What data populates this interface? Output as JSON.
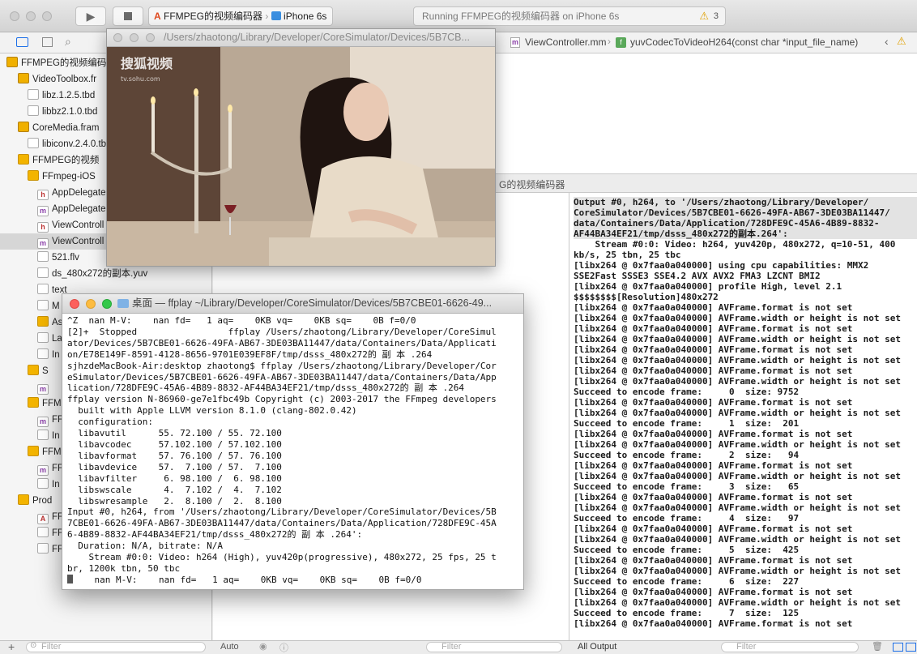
{
  "toolbar": {
    "scheme_name": "FFMPEG的视频编码器",
    "device": "iPhone 6s",
    "status_text": "Running FFMPEG的视频编码器 on iPhone 6s",
    "warning_count": "3"
  },
  "jumpbar": {
    "file": "ViewController.mm",
    "function": "yuvCodecToVideoH264(const char *input_file_name)"
  },
  "navigator": {
    "items": [
      {
        "label": "FFMPEG的视频编码器",
        "icon": "project-icon"
      },
      {
        "label": "VideoToolbox.fr",
        "icon": "framework-icon"
      },
      {
        "label": "libz.1.2.5.tbd",
        "icon": "file-icon"
      },
      {
        "label": "libbz2.1.0.tbd",
        "icon": "file-icon"
      },
      {
        "label": "CoreMedia.fram",
        "icon": "framework-icon"
      },
      {
        "label": "libiconv.2.4.0.tb",
        "icon": "file-icon"
      },
      {
        "label": "FFMPEG的视频",
        "icon": "folder-icon"
      },
      {
        "label": "FFmpeg-iOS",
        "icon": "folder-icon"
      },
      {
        "label": "AppDelegate",
        "icon": "header-file-icon"
      },
      {
        "label": "AppDelegate",
        "icon": "m-file-icon"
      },
      {
        "label": "ViewControll",
        "icon": "header-file-icon"
      },
      {
        "label": "ViewControll",
        "icon": "m-file-icon"
      },
      {
        "label": "521.flv",
        "icon": "video-file-icon"
      },
      {
        "label": "ds_480x272的副本.yuv",
        "icon": "file-icon"
      },
      {
        "label": "text",
        "icon": "file-icon"
      },
      {
        "label": "M",
        "icon": "file-icon"
      },
      {
        "label": "As",
        "icon": "asset-icon"
      },
      {
        "label": "La",
        "icon": "file-icon"
      },
      {
        "label": "In",
        "icon": "file-icon"
      },
      {
        "label": "S",
        "icon": "folder-icon"
      },
      {
        "label": "",
        "icon": "m-file-icon"
      },
      {
        "label": "FFM",
        "icon": "folder-icon"
      },
      {
        "label": "FF",
        "icon": "m-file-icon"
      },
      {
        "label": "In",
        "icon": "file-icon"
      },
      {
        "label": "FFM",
        "icon": "folder-icon"
      },
      {
        "label": "FF",
        "icon": "m-file-icon"
      },
      {
        "label": "In",
        "icon": "file-icon"
      },
      {
        "label": "Prod",
        "icon": "folder-icon"
      },
      {
        "label": "FF",
        "icon": "app-icon"
      },
      {
        "label": "FF",
        "icon": "product-icon"
      },
      {
        "label": "FF",
        "icon": "product-icon"
      }
    ],
    "filter_placeholder": "Filter"
  },
  "debug_bar": {
    "target_label": "G的视频编码器"
  },
  "bottom": {
    "auto_label": "Auto",
    "vars_filter_placeholder": "Filter",
    "output_label": "All Output",
    "console_filter_placeholder": "Filter"
  },
  "player": {
    "title": "/Users/zhaotong/Library/Developer/CoreSimulator/Devices/5B7CB...",
    "watermark": "搜狐视频",
    "watermark_sub": "tv.sohu.com"
  },
  "terminal": {
    "title": "桌面 — ffplay ~/Library/Developer/CoreSimulator/Devices/5B7CBE01-6626-49...",
    "lines": [
      "^Z  nan M-V:    nan fd=   1 aq=    0KB vq=    0KB sq=    0B f=0/0",
      "[2]+  Stopped                 ffplay /Users/zhaotong/Library/Developer/CoreSimul",
      "ator/Devices/5B7CBE01-6626-49FA-AB67-3DE03BA11447/data/Containers/Data/Applicati",
      "on/E78E149F-8591-4128-8656-9701E039EF8F/tmp/dsss_480x272的 副 本 .264",
      "sjhzdeMacBook-Air:desktop zhaotong$ ffplay /Users/zhaotong/Library/Developer/Cor",
      "eSimulator/Devices/5B7CBE01-6626-49FA-AB67-3DE03BA11447/data/Containers/Data/App",
      "lication/728DFE9C-45A6-4B89-8832-AF44BA34EF21/tmp/dsss_480x272的 副 本 .264",
      "ffplay version N-86960-ge7e1fbc49b Copyright (c) 2003-2017 the FFmpeg developers",
      "  built with Apple LLVM version 8.1.0 (clang-802.0.42)",
      "  configuration:",
      "  libavutil      55. 72.100 / 55. 72.100",
      "  libavcodec     57.102.100 / 57.102.100",
      "  libavformat    57. 76.100 / 57. 76.100",
      "  libavdevice    57.  7.100 / 57.  7.100",
      "  libavfilter     6. 98.100 /  6. 98.100",
      "  libswscale      4.  7.102 /  4.  7.102",
      "  libswresample   2.  8.100 /  2.  8.100",
      "Input #0, h264, from '/Users/zhaotong/Library/Developer/CoreSimulator/Devices/5B",
      "7CBE01-6626-49FA-AB67-3DE03BA11447/data/Containers/Data/Application/728DFE9C-45A",
      "6-4B89-8832-AF44BA34EF21/tmp/dsss_480x272的 副 本 .264':",
      "  Duration: N/A, bitrate: N/A",
      "    Stream #0:0: Video: h264 (High), yuv420p(progressive), 480x272, 25 fps, 25 t",
      "br, 1200k tbn, 50 tbc"
    ],
    "last_line": "    nan M-V:    nan fd=   1 aq=    0KB vq=    0KB sq=    0B f=0/0"
  },
  "console": {
    "lines": [
      {
        "t": "Output #0, h264, to '/Users/zhaotong/Library/Developer/",
        "hl": true
      },
      {
        "t": "CoreSimulator/Devices/5B7CBE01-6626-49FA-AB67-3DE03BA11447/",
        "hl": true
      },
      {
        "t": "data/Containers/Data/Application/728DFE9C-45A6-4B89-8832-",
        "hl": true
      },
      {
        "t": "AF44BA34EF21/tmp/dsss_480x272的副本.264':",
        "hl": true
      },
      {
        "t": "    Stream #0:0: Video: h264, yuv420p, 480x272, q=10-51, 400",
        "hl": false
      },
      {
        "t": "kb/s, 25 tbn, 25 tbc",
        "hl": false
      },
      {
        "t": "[libx264 @ 0x7faa0a040000] using cpu capabilities: MMX2",
        "hl": false
      },
      {
        "t": "SSE2Fast SSSE3 SSE4.2 AVX AVX2 FMA3 LZCNT BMI2",
        "hl": false
      },
      {
        "t": "[libx264 @ 0x7faa0a040000] profile High, level 2.1",
        "hl": false
      },
      {
        "t": "$$$$$$$$[Resolution]480x272",
        "hl": false
      },
      {
        "t": "[libx264 @ 0x7faa0a040000] AVFrame.format is not set",
        "hl": false
      },
      {
        "t": "[libx264 @ 0x7faa0a040000] AVFrame.width or height is not set",
        "hl": false
      },
      {
        "t": "[libx264 @ 0x7faa0a040000] AVFrame.format is not set",
        "hl": false
      },
      {
        "t": "[libx264 @ 0x7faa0a040000] AVFrame.width or height is not set",
        "hl": false
      },
      {
        "t": "[libx264 @ 0x7faa0a040000] AVFrame.format is not set",
        "hl": false
      },
      {
        "t": "[libx264 @ 0x7faa0a040000] AVFrame.width or height is not set",
        "hl": false
      },
      {
        "t": "[libx264 @ 0x7faa0a040000] AVFrame.format is not set",
        "hl": false
      },
      {
        "t": "[libx264 @ 0x7faa0a040000] AVFrame.width or height is not set",
        "hl": false
      },
      {
        "t": "Succeed to encode frame:     0  size: 9752",
        "hl": false
      },
      {
        "t": "[libx264 @ 0x7faa0a040000] AVFrame.format is not set",
        "hl": false
      },
      {
        "t": "[libx264 @ 0x7faa0a040000] AVFrame.width or height is not set",
        "hl": false
      },
      {
        "t": "Succeed to encode frame:     1  size:  201",
        "hl": false
      },
      {
        "t": "[libx264 @ 0x7faa0a040000] AVFrame.format is not set",
        "hl": false
      },
      {
        "t": "[libx264 @ 0x7faa0a040000] AVFrame.width or height is not set",
        "hl": false
      },
      {
        "t": "Succeed to encode frame:     2  size:   94",
        "hl": false
      },
      {
        "t": "[libx264 @ 0x7faa0a040000] AVFrame.format is not set",
        "hl": false
      },
      {
        "t": "[libx264 @ 0x7faa0a040000] AVFrame.width or height is not set",
        "hl": false
      },
      {
        "t": "Succeed to encode frame:     3  size:   65",
        "hl": false
      },
      {
        "t": "[libx264 @ 0x7faa0a040000] AVFrame.format is not set",
        "hl": false
      },
      {
        "t": "[libx264 @ 0x7faa0a040000] AVFrame.width or height is not set",
        "hl": false
      },
      {
        "t": "Succeed to encode frame:     4  size:   97",
        "hl": false
      },
      {
        "t": "[libx264 @ 0x7faa0a040000] AVFrame.format is not set",
        "hl": false
      },
      {
        "t": "[libx264 @ 0x7faa0a040000] AVFrame.width or height is not set",
        "hl": false
      },
      {
        "t": "Succeed to encode frame:     5  size:  425",
        "hl": false
      },
      {
        "t": "[libx264 @ 0x7faa0a040000] AVFrame.format is not set",
        "hl": false
      },
      {
        "t": "[libx264 @ 0x7faa0a040000] AVFrame.width or height is not set",
        "hl": false
      },
      {
        "t": "Succeed to encode frame:     6  size:  227",
        "hl": false
      },
      {
        "t": "[libx264 @ 0x7faa0a040000] AVFrame.format is not set",
        "hl": false
      },
      {
        "t": "[libx264 @ 0x7faa0a040000] AVFrame.width or height is not set",
        "hl": false
      },
      {
        "t": "Succeed to encode frame:     7  size:  125",
        "hl": false
      },
      {
        "t": "[libx264 @ 0x7faa0a040000] AVFrame.format is not set",
        "hl": false
      }
    ]
  },
  "colors": {
    "accent": "#1b6ee8",
    "warning": "#f0b400",
    "close_red": "#fc605c",
    "minimize_yellow": "#fdbc40",
    "zoom_green": "#34c84a"
  }
}
